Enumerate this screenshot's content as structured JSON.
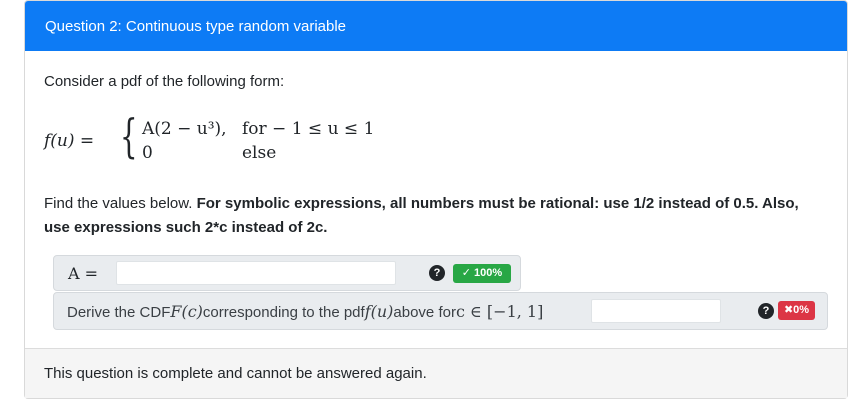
{
  "header": {
    "title": "Question 2: Continuous type random variable"
  },
  "body": {
    "intro": "Consider a pdf of the following form:",
    "formula": {
      "lhs": "f(u) =",
      "brace": "{",
      "case1_expr": "A(2 − u³),",
      "case1_cond": "for  − 1 ≤ u ≤ 1",
      "case2_expr": "0",
      "case2_cond": "else"
    },
    "instructions": {
      "plain": "Find the values below. ",
      "bold": "For symbolic expressions, all numbers must be rational: use 1/2 instead of 0.5. Also, use expressions such 2*c instead of 2c."
    }
  },
  "questions": [
    {
      "label": "A =",
      "value": "",
      "help_icon": "question-circle-icon",
      "badge": {
        "icon": "check-icon",
        "text": "✓ 100%",
        "color": "#28a745"
      }
    },
    {
      "label_parts": [
        "Derive the CDF",
        "F(c)",
        "corresponding to the pdf",
        "f(u)",
        "above for",
        "c ∈ [−1, 1]"
      ],
      "value": "",
      "help_icon": "question-circle-icon",
      "badge": {
        "icon": "x-icon",
        "text": "✖0%",
        "color": "#dc3545"
      }
    }
  ],
  "footer": {
    "text": "This question is complete and cannot be answered again."
  },
  "colors": {
    "header_bg": "#0d7bf5",
    "success": "#28a745",
    "danger": "#dc3545"
  }
}
